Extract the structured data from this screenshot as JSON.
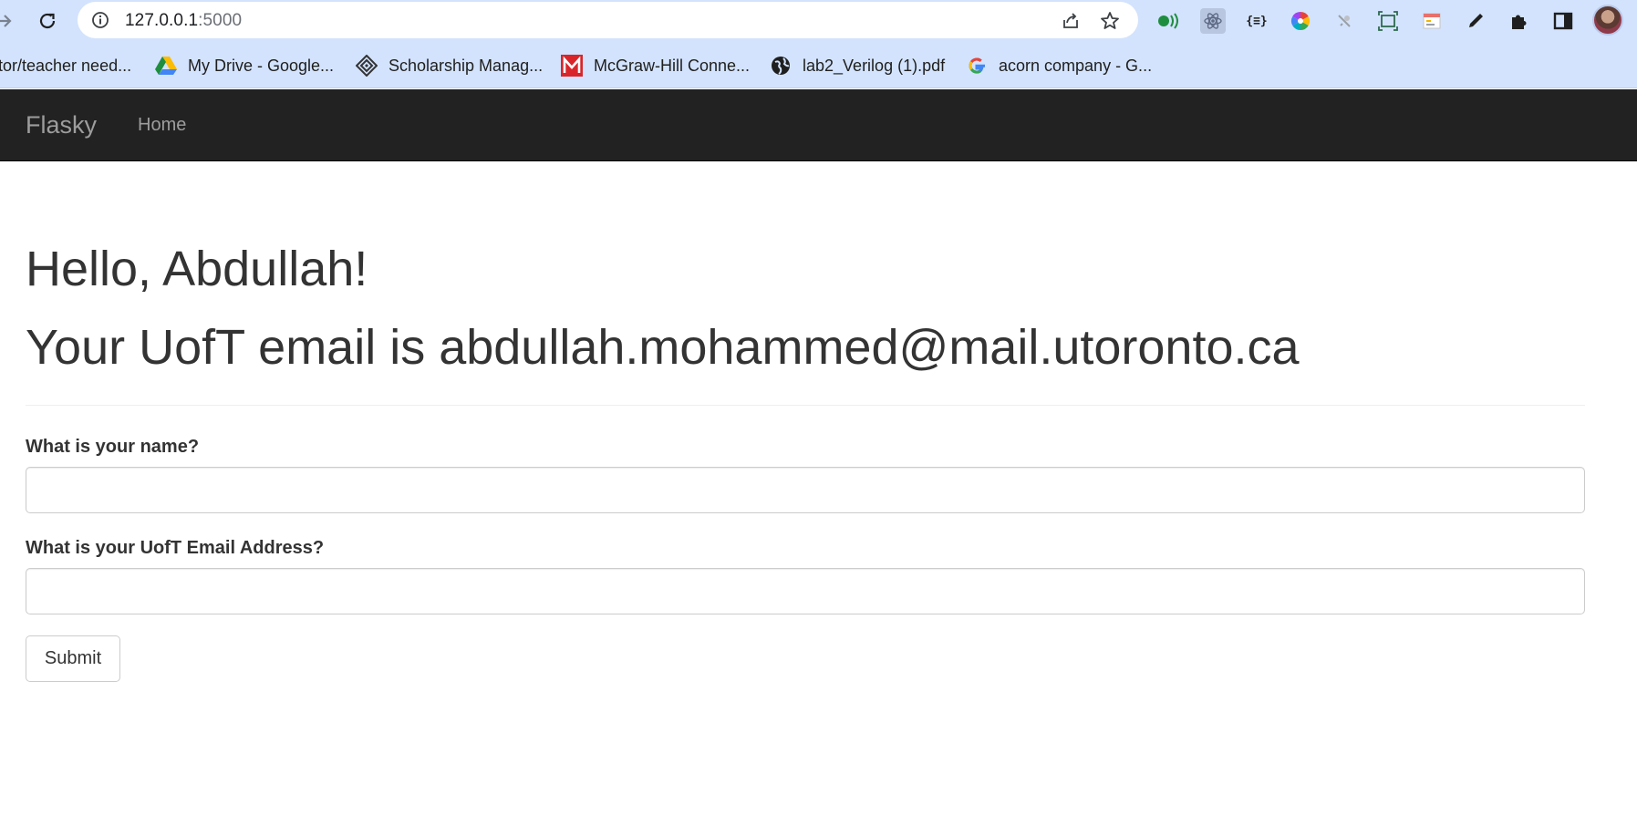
{
  "browser": {
    "url_host": "127.0.0.1",
    "url_port": ":5000",
    "bookmarks": [
      {
        "label": "tor/teacher need...",
        "icon": "none"
      },
      {
        "label": "My Drive - Google...",
        "icon": "google-drive-icon"
      },
      {
        "label": "Scholarship Manag...",
        "icon": "diamond-logo-icon"
      },
      {
        "label": "McGraw-Hill Conne...",
        "icon": "mcgraw-hill-icon"
      },
      {
        "label": "lab2_Verilog (1).pdf",
        "icon": "globe-icon"
      },
      {
        "label": "acorn company - G...",
        "icon": "google-icon"
      }
    ],
    "extensions": [
      "green-signal-icon",
      "react-atom-icon",
      "json-braces-icon",
      "color-wheel-icon",
      "bug-icon",
      "screenshot-frame-icon",
      "calendar-icon",
      "eyedropper-icon",
      "puzzle-piece-icon",
      "side-panel-icon"
    ]
  },
  "navbar": {
    "brand": "Flasky",
    "home": "Home",
    "background": "#222222",
    "text_color": "#9d9d9d"
  },
  "page": {
    "greeting": "Hello, Abdullah!",
    "email_line": "Your UofT email is abdullah.mohammed@mail.utoronto.ca"
  },
  "form": {
    "name_label": "What is your name?",
    "name_value": "",
    "email_label": "What is your UofT Email Address?",
    "email_value": "",
    "submit_label": "Submit"
  }
}
